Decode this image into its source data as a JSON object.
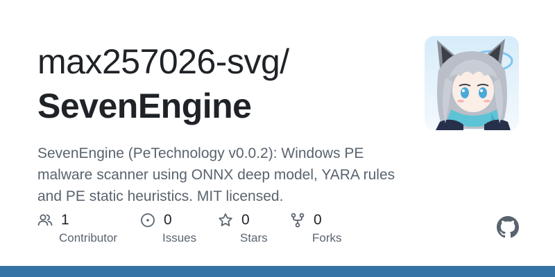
{
  "repo_card": {
    "owner_path": "max257026-svg/",
    "repo_name": "SevenEngine",
    "description": "SevenEngine (PeTechnology v0.0.2): Windows PE malware scanner using ONNX deep model, YARA rules and PE static heuristics. MIT licensed.",
    "avatar_icon": "anime-character-avatar",
    "stats": [
      {
        "icon": "people-icon",
        "value": "1",
        "label": "Contributor"
      },
      {
        "icon": "issue-circle-icon",
        "value": "0",
        "label": "Issues"
      },
      {
        "icon": "star-icon",
        "value": "0",
        "label": "Stars"
      },
      {
        "icon": "fork-icon",
        "value": "0",
        "label": "Forks"
      }
    ],
    "logo_icon": "github-mark-icon"
  },
  "colors": {
    "text_primary": "#1f2328",
    "text_secondary": "#59636e",
    "bottom_bar": "#3572A5"
  }
}
